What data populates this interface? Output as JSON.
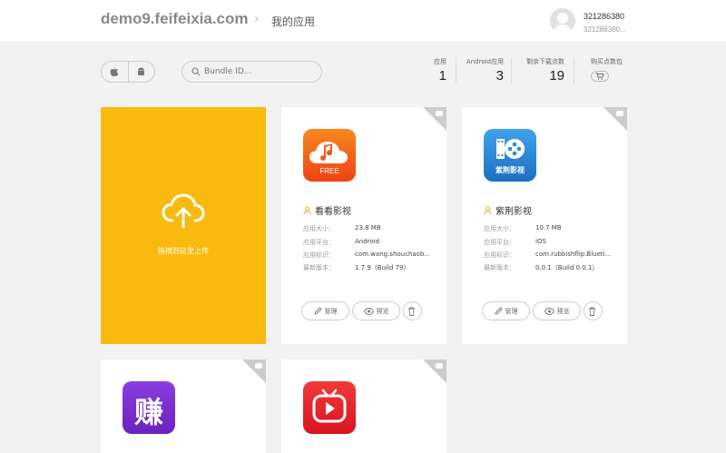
{
  "header": {
    "site": "demo9.feifeixia.com",
    "crumb": "我的应用",
    "user_name": "321286380",
    "user_sub": "321286380..."
  },
  "toolbar": {
    "platform_ios": "",
    "platform_android": "",
    "search_placeholder": "Bundle ID..."
  },
  "stats": {
    "ios_label": "应用",
    "ios_value": "1",
    "android_label": "Android应用",
    "android_value": "3",
    "downloads_label": "剩余下载点数",
    "downloads_value": "19",
    "buy_label": "购买点数包"
  },
  "upload": {
    "label": "拖拽到这里上传"
  },
  "labels": {
    "size": "应用大小：",
    "platform": "应用平台：",
    "bundle": "应用标识：",
    "version": "最新版本：",
    "manage": "管理",
    "preview": "预览"
  },
  "apps": [
    {
      "name": "看看影视",
      "size": "23.8 MB",
      "platform": "Android",
      "bundle": "com.wang.shouchaob...",
      "version": "1.7.9（Build 79）",
      "icon_text": "FREE",
      "icon_color": "#f25a16"
    },
    {
      "name": "紫荆影视",
      "size": "10.7 MB",
      "platform": "iOS",
      "bundle": "com.rubbishflip.Blueti...",
      "version": "0.0.1（Build 0.0.1）",
      "icon_text": "紫荆影视",
      "icon_color": "#2a8dd8"
    },
    {
      "icon_text": "赚",
      "icon_color": "#7b2fd0"
    },
    {
      "icon_color": "#e51e2a"
    }
  ]
}
